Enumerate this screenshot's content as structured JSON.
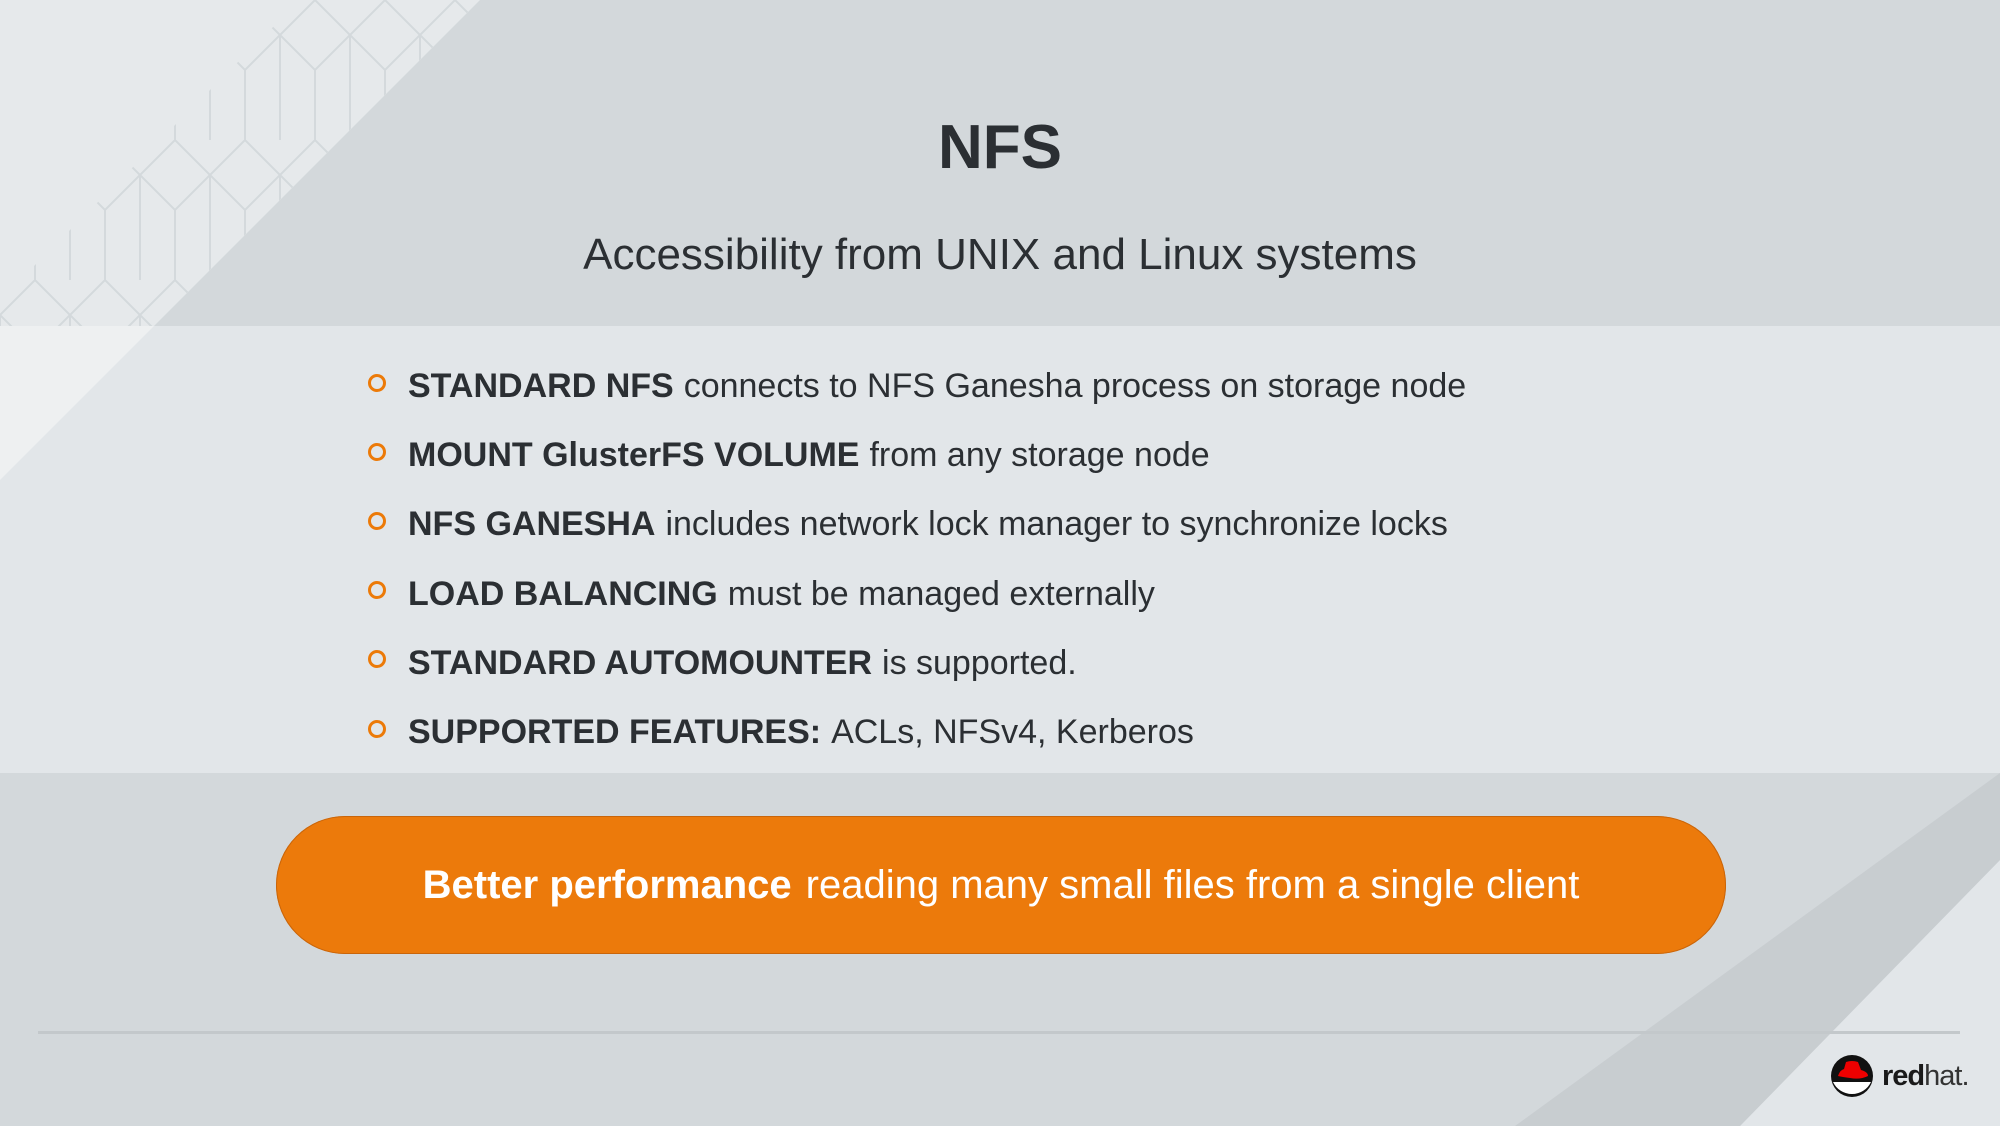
{
  "slide": {
    "title": "NFS",
    "subtitle": "Accessibility from UNIX and Linux systems",
    "bullets": [
      {
        "bold": "STANDARD NFS",
        "text": "connects to NFS Ganesha process on storage node"
      },
      {
        "bold": "MOUNT GlusterFS VOLUME",
        "text": "from any storage node"
      },
      {
        "bold": "NFS GANESHA",
        "text": "includes network lock manager to synchronize locks"
      },
      {
        "bold": "LOAD BALANCING",
        "text": "must be managed externally"
      },
      {
        "bold": "STANDARD AUTOMOUNTER",
        "text": "is supported."
      },
      {
        "bold": "SUPPORTED FEATURES:",
        "text": "ACLs, NFSv4, Kerberos"
      }
    ],
    "callout": {
      "bold": "Better performance",
      "text": "reading many small files from a single client"
    },
    "logo": {
      "part1": "red",
      "part2": "hat."
    }
  },
  "colors": {
    "accent": "#ec7a08",
    "text": "#2b2f33",
    "background": "#d3d8db"
  }
}
